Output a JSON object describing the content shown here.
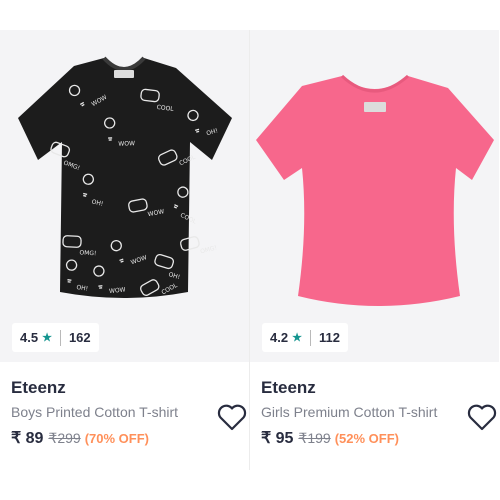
{
  "products": [
    {
      "brand": "Eteenz",
      "name": "Boys Printed Cotton T-shirt",
      "price": "₹ 89",
      "mrp": "₹299",
      "discount": "(70% OFF)",
      "rating": "4.5",
      "rating_count": "162",
      "tee_color": "#1c1c1c",
      "print_texts": [
        "WOW",
        "COOL",
        "OH!",
        "OMG!",
        "WOW",
        "COOL",
        "OH!",
        "WOW",
        "COOL",
        "OMG!",
        "WOW",
        "OH!"
      ]
    },
    {
      "brand": "Eteenz",
      "name": "Girls Premium Cotton T-shirt",
      "price": "₹ 95",
      "mrp": "₹199",
      "discount": "(52% OFF)",
      "rating": "4.2",
      "rating_count": "112",
      "tee_color": "#f7678c"
    }
  ],
  "icons": {
    "rating_star": "star-icon",
    "wishlist": "heart-outline-icon"
  },
  "colors": {
    "rating_star": "#14958f",
    "discount": "#ff905a",
    "brand_text": "#282c3f",
    "muted_text": "#7e818c"
  }
}
